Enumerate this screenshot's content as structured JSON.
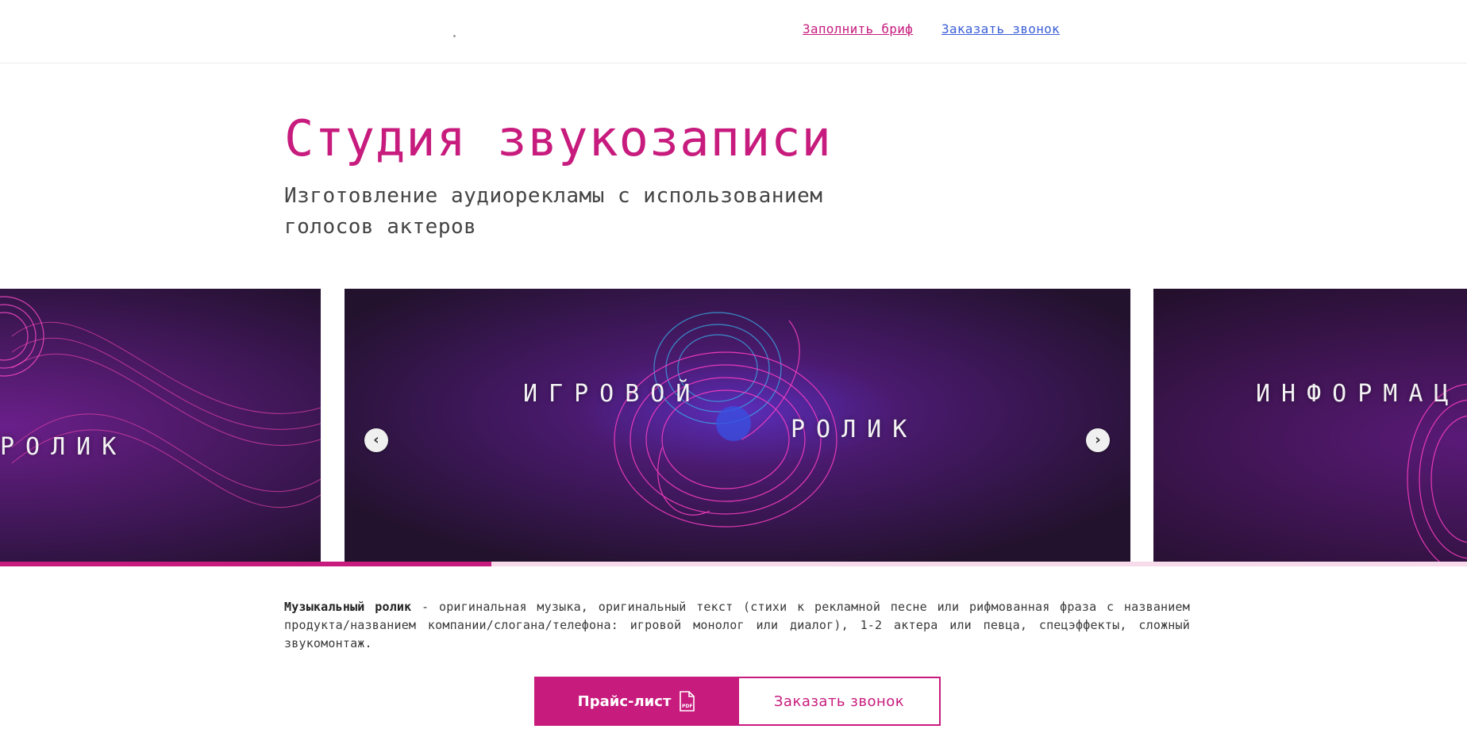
{
  "header": {
    "brief_link": "Заполнить бриф",
    "call_link": "Заказать звонок"
  },
  "hero": {
    "title": "Студия звукозаписи",
    "subtitle": "Изготовление аудиорекламы с использованием голосов актеров"
  },
  "slider": {
    "slides": [
      {
        "word1": "",
        "word2": "РОЛИК"
      },
      {
        "word1": "ИГРОВОЙ",
        "word2": "РОЛИК"
      },
      {
        "word1": "ИНФОРМАЦ",
        "word2": ""
      }
    ],
    "progress_fraction": 0.335,
    "colors": {
      "accent": "#c71b7d",
      "track": "#f7dbea",
      "slide_bg": "#241230"
    }
  },
  "description": {
    "bold": "Музыкальный ролик",
    "text": " - оригинальная музыка, оригинальный текст (стихи к рекламной песне или рифмованная фраза с названием продукта/названием компании/слогана/телефона: игровой монолог или диалог), 1-2 актера или певца, спецэффекты, сложный звукомонтаж."
  },
  "buttons": {
    "price_label": "Прайс-лист",
    "price_icon": "pdf-icon",
    "pdf_badge": "PDF",
    "call_label": "Заказать звонок"
  },
  "icons": {
    "prev": "chevron-left-icon",
    "next": "chevron-right-icon"
  }
}
